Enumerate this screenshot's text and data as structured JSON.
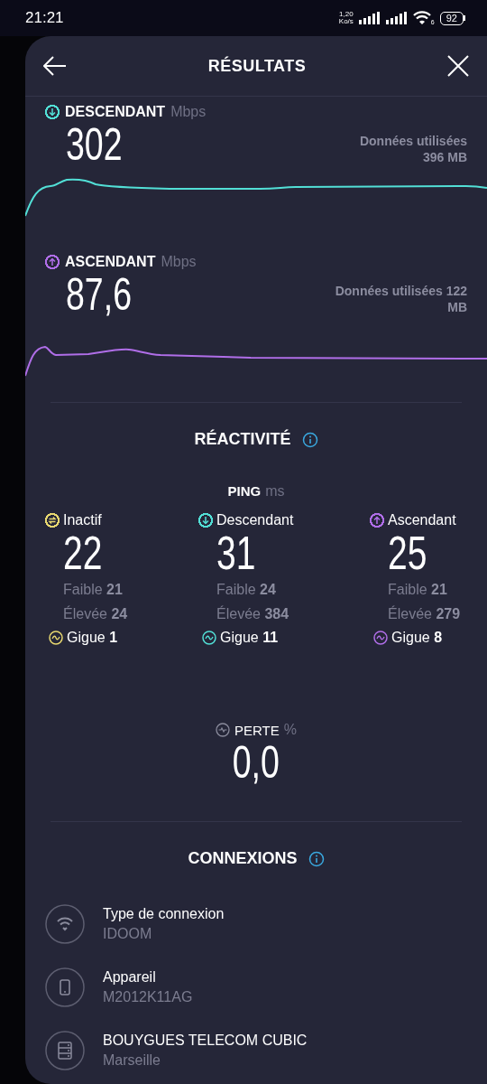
{
  "status_bar": {
    "time": "21:21",
    "net_speed": "1,20",
    "net_unit": "Ko/s",
    "wifi_badge": "6",
    "battery": "92"
  },
  "header": {
    "title": "RÉSULTATS"
  },
  "speeds": [
    {
      "kind": "download",
      "label": "DESCENDANT",
      "unit": "Mbps",
      "value": "302",
      "data_lines": [
        "Données utilisées",
        "396 MB"
      ],
      "color": "#52dfd6"
    },
    {
      "kind": "upload",
      "label": "ASCENDANT",
      "unit": "Mbps",
      "value": "87,6",
      "data_lines": [
        "Données utilisées 122",
        "MB"
      ],
      "color": "#b06ee8"
    }
  ],
  "reactivity": {
    "title": "RÉACTIVITÉ"
  },
  "ping": {
    "label": "PING",
    "unit": "ms",
    "columns": [
      {
        "kind": "idle",
        "label": "Inactif",
        "value": "22",
        "low_label": "Faible",
        "low": "21",
        "high_label": "Élevée",
        "high": "24",
        "jitter_label": "Gigue",
        "jitter": "1",
        "color": "#e8d870"
      },
      {
        "kind": "download",
        "label": "Descendant",
        "value": "31",
        "low_label": "Faible",
        "low": "24",
        "high_label": "Élevée",
        "high": "384",
        "jitter_label": "Gigue",
        "jitter": "11",
        "color": "#52dfd6"
      },
      {
        "kind": "upload",
        "label": "Ascendant",
        "value": "25",
        "low_label": "Faible",
        "low": "21",
        "high_label": "Élevée",
        "high": "279",
        "jitter_label": "Gigue",
        "jitter": "8",
        "color": "#b06ee8"
      }
    ]
  },
  "loss": {
    "label": "PERTE",
    "unit": "%",
    "value": "0,0"
  },
  "connections": {
    "title": "CONNEXIONS",
    "items": [
      {
        "kind": "wifi",
        "title": "Type de connexion",
        "value": "IDOOM"
      },
      {
        "kind": "device",
        "title": "Appareil",
        "value": "M2012K11AG"
      },
      {
        "kind": "server",
        "title": "BOUYGUES TELECOM CUBIC",
        "value": "Marseille"
      }
    ]
  }
}
